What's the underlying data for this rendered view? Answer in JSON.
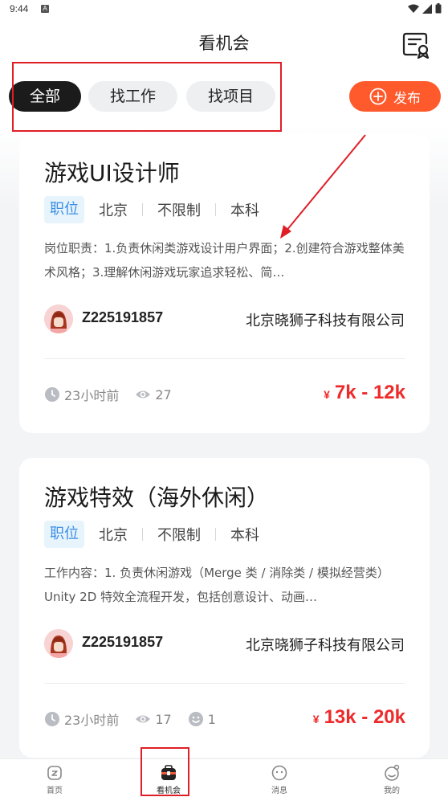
{
  "status_bar": {
    "time": "9:44",
    "notification_badge": "A"
  },
  "header": {
    "title": "看机会",
    "icon": "resume-badge-icon"
  },
  "filters": {
    "tabs": [
      {
        "label": "全部",
        "active": true
      },
      {
        "label": "找工作",
        "active": false
      },
      {
        "label": "找项目",
        "active": false
      }
    ],
    "publish_label": "发布"
  },
  "jobs": [
    {
      "title": "游戏UI设计师",
      "tag": "职位",
      "city": "北京",
      "experience": "不限制",
      "education": "本科",
      "description": "岗位职责：1.负责休闲类游戏设计用户界面；2.创建符合游戏整体美术风格；3.理解休闲游戏玩家追求轻松、简…",
      "user_id": "Z225191857",
      "company": "北京晓狮子科技有限公司",
      "posted": "23小时前",
      "views": "27",
      "salary_currency": "¥",
      "salary": "7k - 12k"
    },
    {
      "title": "游戏特效（海外休闲）",
      "tag": "职位",
      "city": "北京",
      "experience": "不限制",
      "education": "本科",
      "description": "工作内容：1. 负责休闲游戏（Merge 类 / 消除类 / 模拟经营类）Unity 2D 特效全流程开发，包括创意设计、动画…",
      "user_id": "Z225191857",
      "company": "北京晓狮子科技有限公司",
      "posted": "23小时前",
      "views": "17",
      "likes": "1",
      "salary_currency": "¥",
      "salary": "13k - 20k"
    }
  ],
  "bottom_nav": [
    {
      "label": "首页",
      "icon": "home-icon"
    },
    {
      "label": "看机会",
      "icon": "briefcase-icon",
      "active": true
    },
    {
      "label": "消息",
      "icon": "message-icon"
    },
    {
      "label": "我的",
      "icon": "profile-icon"
    }
  ],
  "colors": {
    "accent": "#ff5a2c",
    "salary": "#ee2a2a",
    "tag_bg": "#e8f4fc",
    "tag_text": "#3a8ee6",
    "annotation": "#e01e26"
  }
}
